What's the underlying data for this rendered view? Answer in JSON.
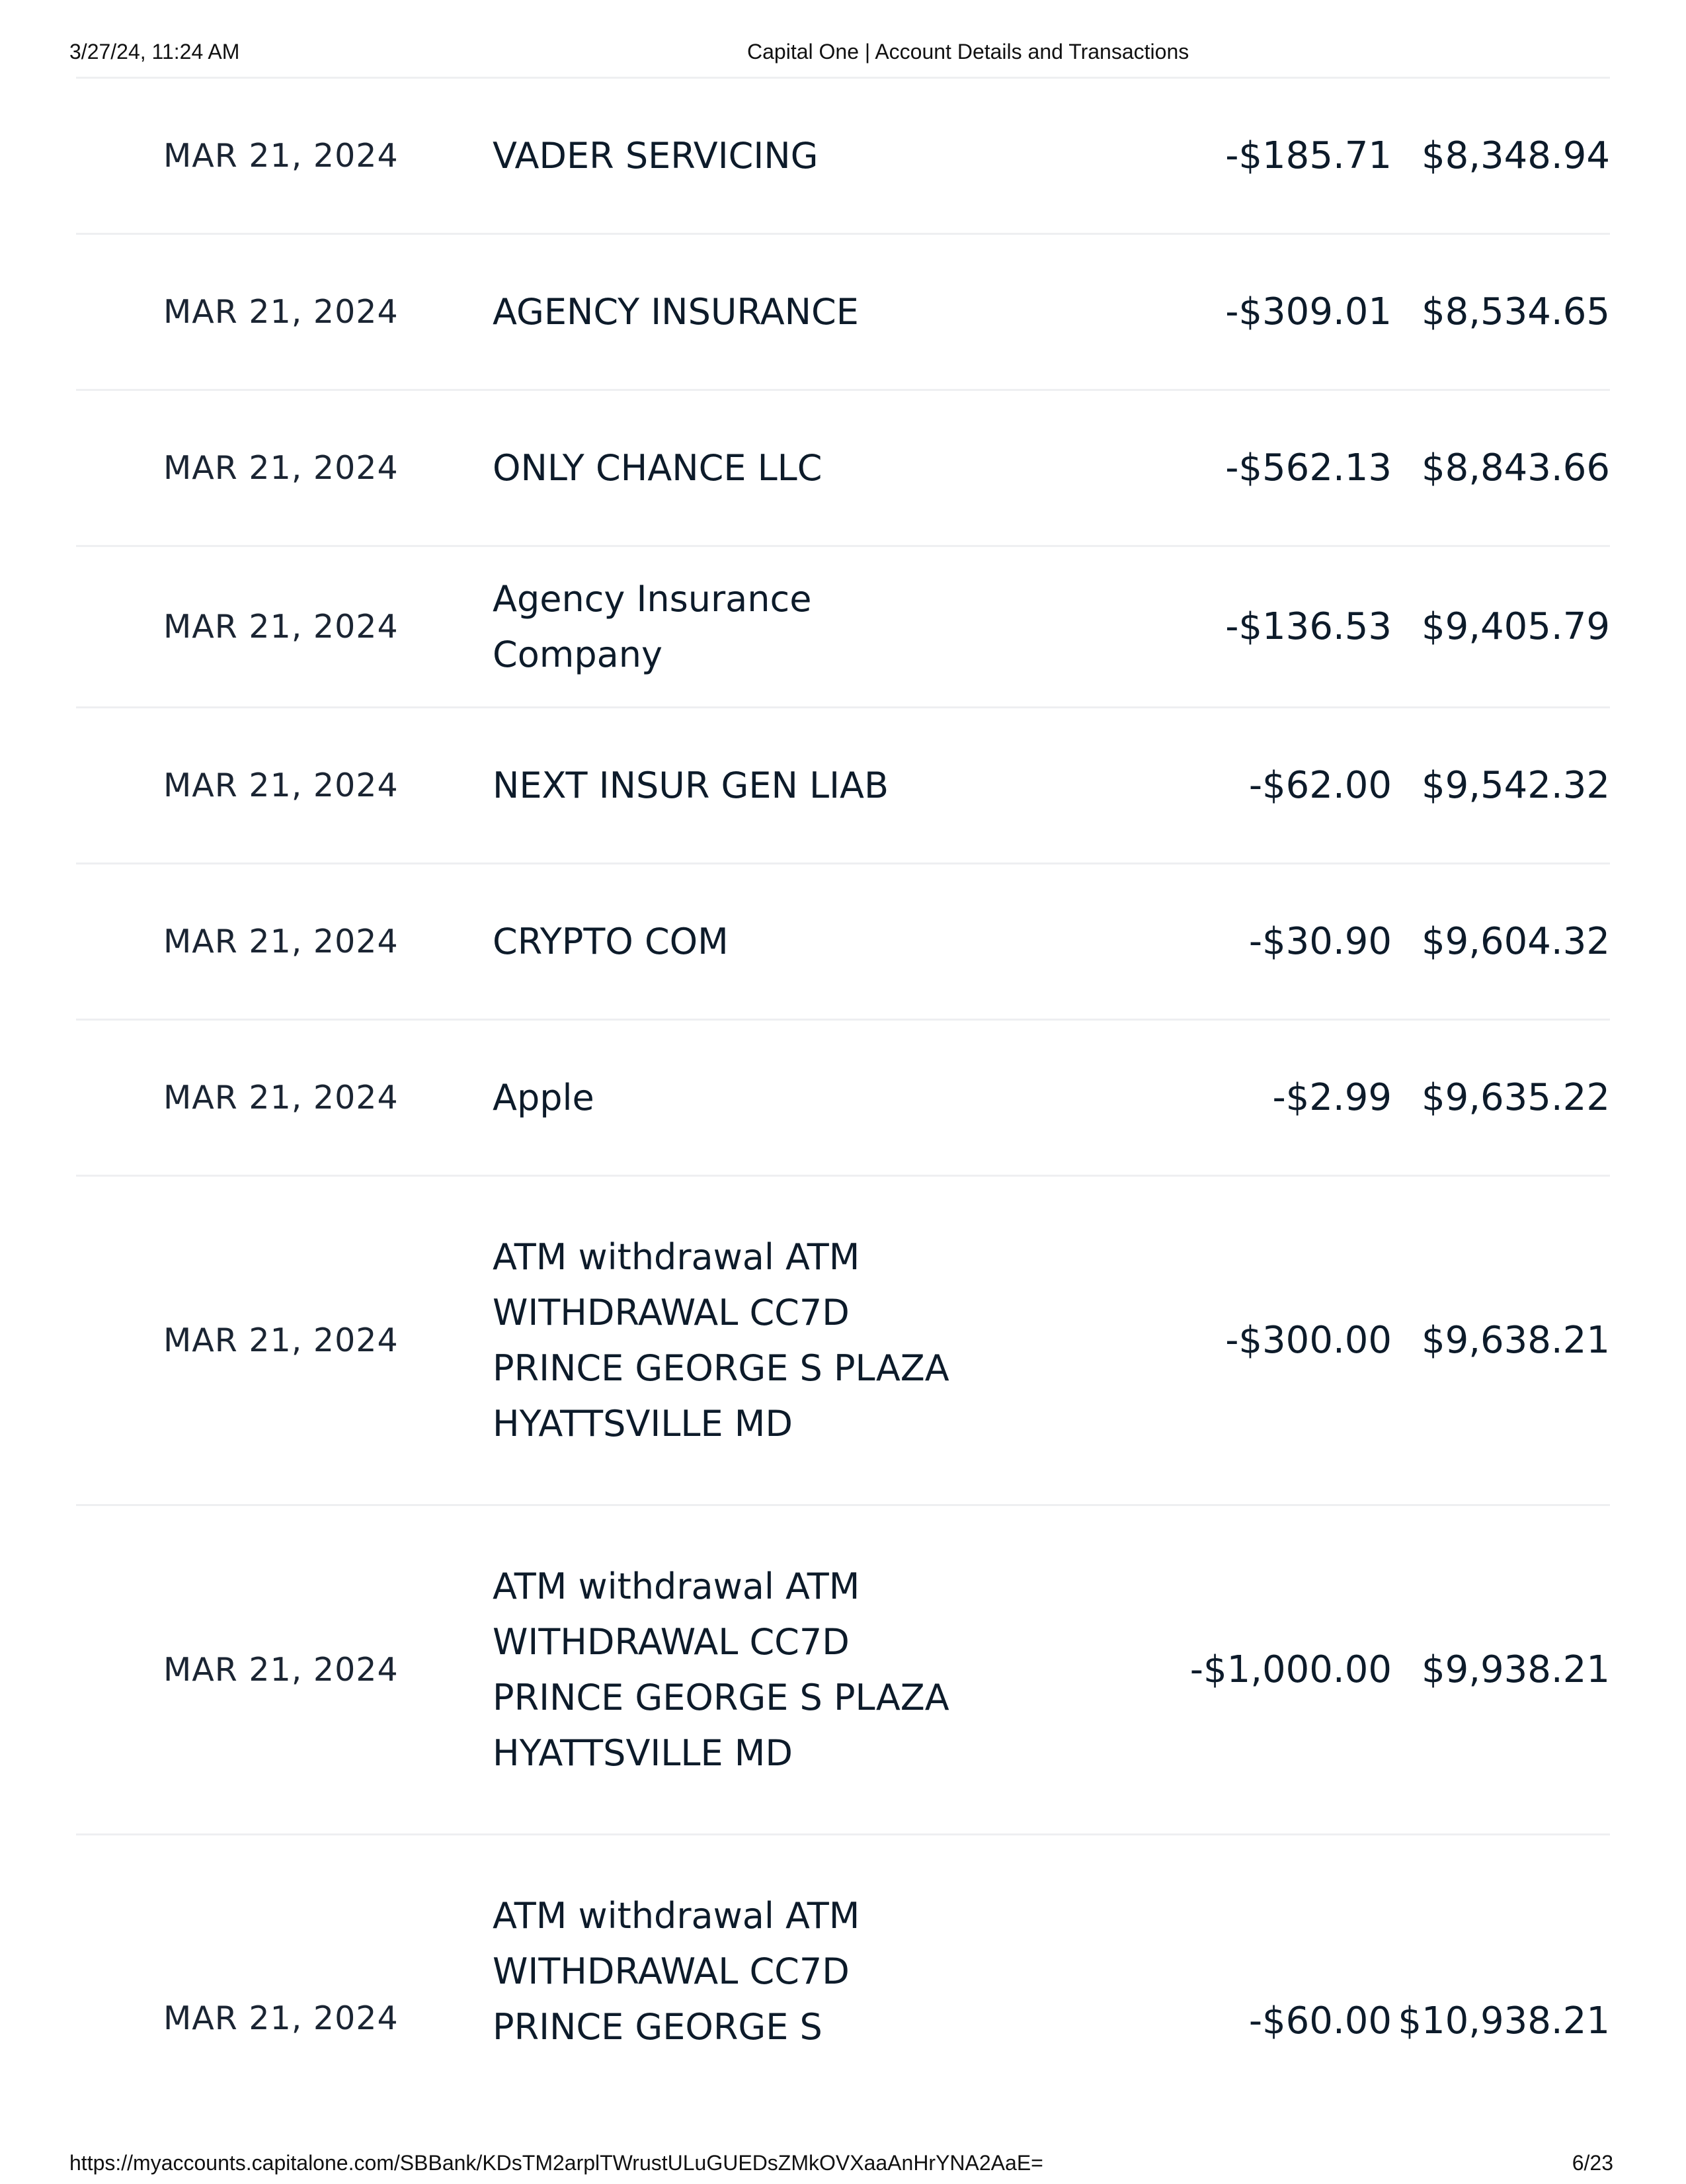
{
  "print_header": {
    "datetime": "3/27/24, 11:24 AM",
    "title": "Capital One | Account Details and Transactions"
  },
  "print_footer": {
    "url": "https://myaccounts.capitalone.com/SBBank/KDsTM2arplTWrustULuGUEDsZMkOVXaaAnHrYNA2AaE=",
    "page": "6/23"
  },
  "transactions": [
    {
      "date": "MAR 21, 2024",
      "description": "VADER SERVICING",
      "amount": "-$185.71",
      "balance": "$8,348.94"
    },
    {
      "date": "MAR 21, 2024",
      "description": "AGENCY INSURANCE",
      "amount": "-$309.01",
      "balance": "$8,534.65"
    },
    {
      "date": "MAR 21, 2024",
      "description": "ONLY CHANCE LLC",
      "amount": "-$562.13",
      "balance": "$8,843.66"
    },
    {
      "date": "MAR 21, 2024",
      "description": "Agency Insurance Company",
      "amount": "-$136.53",
      "balance": "$9,405.79"
    },
    {
      "date": "MAR 21, 2024",
      "description": "NEXT INSUR GEN LIAB",
      "amount": "-$62.00",
      "balance": "$9,542.32"
    },
    {
      "date": "MAR 21, 2024",
      "description": "CRYPTO COM",
      "amount": "-$30.90",
      "balance": "$9,604.32"
    },
    {
      "date": "MAR 21, 2024",
      "description": "Apple",
      "amount": "-$2.99",
      "balance": "$9,635.22"
    },
    {
      "date": "MAR 21, 2024",
      "description": "ATM withdrawal ATM WITHDRAWAL CC7D PRINCE GEORGE S PLAZA HYATTSVILLE MD",
      "amount": "-$300.00",
      "balance": "$9,638.21"
    },
    {
      "date": "MAR 21, 2024",
      "description": "ATM withdrawal ATM WITHDRAWAL CC7D PRINCE GEORGE S PLAZA HYATTSVILLE MD",
      "amount": "-$1,000.00",
      "balance": "$9,938.21"
    },
    {
      "date": "MAR 21, 2024",
      "description": "ATM withdrawal ATM WITHDRAWAL CC7D PRINCE GEORGE S",
      "amount": "-$60.00",
      "balance": "$10,938.21"
    }
  ]
}
